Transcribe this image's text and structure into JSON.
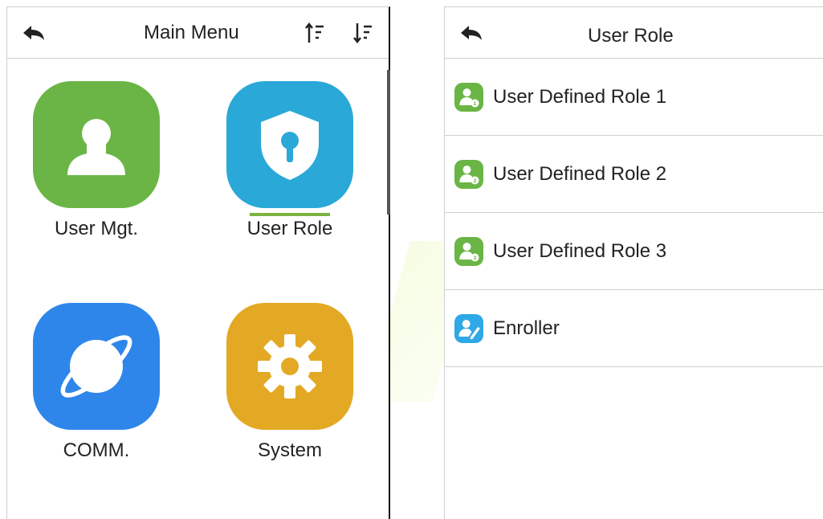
{
  "left_screen": {
    "title": "Main Menu",
    "tiles": [
      {
        "label": "User Mgt.",
        "icon": "user-icon",
        "color": "#6ab545"
      },
      {
        "label": "User Role",
        "icon": "shield-lock-icon",
        "color": "#2aa8d8"
      },
      {
        "label": "COMM.",
        "icon": "planet-icon",
        "color": "#2f86ea"
      },
      {
        "label": "System",
        "icon": "gear-icon",
        "color": "#e3a925"
      }
    ]
  },
  "right_screen": {
    "title": "User Role",
    "items": [
      {
        "label": "User Defined Role 1",
        "icon": "user-role-1-icon",
        "color": "#6ab545"
      },
      {
        "label": "User Defined Role 2",
        "icon": "user-role-2-icon",
        "color": "#6ab545"
      },
      {
        "label": "User Defined Role 3",
        "icon": "user-role-3-icon",
        "color": "#6ab545"
      },
      {
        "label": "Enroller",
        "icon": "enroller-icon",
        "color": "#2ea8e6"
      }
    ]
  }
}
